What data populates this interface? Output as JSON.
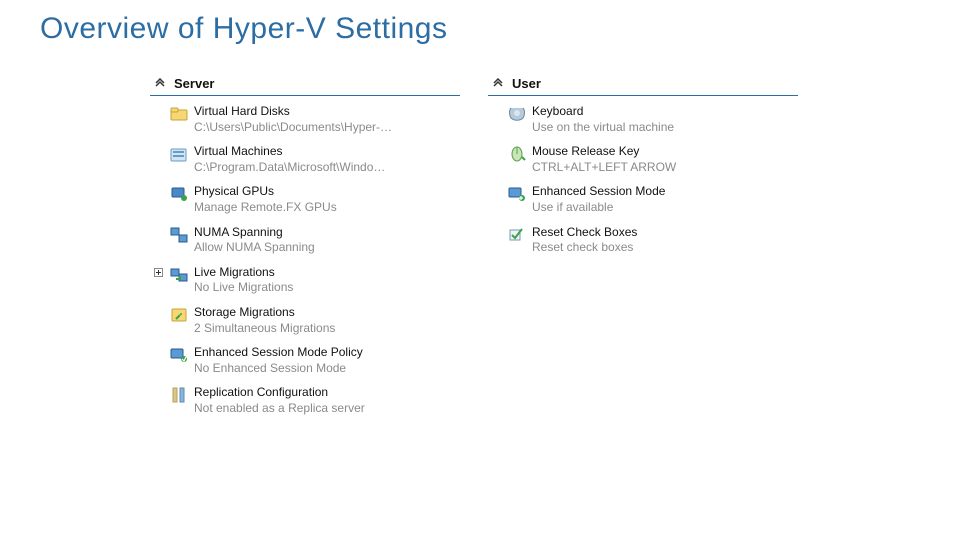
{
  "title": "Overview of Hyper-V Settings",
  "server": {
    "header": "Server",
    "items": [
      {
        "label": "Virtual Hard Disks",
        "sub": "C:\\Users\\Public\\Documents\\Hyper-…",
        "icon": "folder"
      },
      {
        "label": "Virtual Machines",
        "sub": "C:\\Program.Data\\Microsoft\\Windo…",
        "icon": "folder2"
      },
      {
        "label": "Physical GPUs",
        "sub": "Manage Remote.FX GPUs",
        "icon": "gpu"
      },
      {
        "label": "NUMA Spanning",
        "sub": "Allow NUMA Spanning",
        "icon": "numa"
      },
      {
        "label": "Live Migrations",
        "sub": "No Live Migrations",
        "icon": "live",
        "expand": true
      },
      {
        "label": "Storage Migrations",
        "sub": "2 Simultaneous Migrations",
        "icon": "storage"
      },
      {
        "label": "Enhanced Session Mode Policy",
        "sub": "No Enhanced Session Mode",
        "icon": "esm"
      },
      {
        "label": "Replication Configuration",
        "sub": "Not enabled as a Replica server",
        "icon": "repl"
      }
    ]
  },
  "user": {
    "header": "User",
    "items": [
      {
        "label": "Keyboard",
        "sub": "Use on the virtual machine",
        "icon": "keyboard"
      },
      {
        "label": "Mouse Release Key",
        "sub": "CTRL+ALT+LEFT ARROW",
        "icon": "mouse"
      },
      {
        "label": "Enhanced Session Mode",
        "sub": "Use if available",
        "icon": "esm2"
      },
      {
        "label": "Reset Check Boxes",
        "sub": "Reset check boxes",
        "icon": "reset"
      }
    ]
  }
}
